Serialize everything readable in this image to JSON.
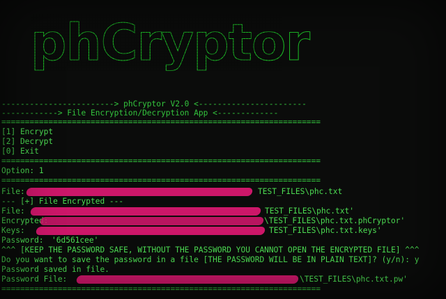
{
  "banner": {
    "text": "phCryptor"
  },
  "lines": {
    "sep1": "------------------------> phCryptor V2.0 <-----------------------",
    "sep2": "------------> File Encryption/Decryption App <-------------",
    "sep3": "====================================================================",
    "menu_1": "[1] Encrypt",
    "menu_2": "[2] Decrypt",
    "menu_0": "[0] Exit",
    "sep4": "====================================================================",
    "option": "Option: 1",
    "sep5": "====================================================================",
    "file_label": "File:",
    "file_tail": "TEST_FILES\\phc.txt",
    "encrypted_header": "--- [+] File Encrypted ---",
    "file2_label": "File:",
    "file2_tail": "TEST_FILES\\phc.txt'",
    "encrypted_label": "Encrypted:",
    "encrypted_tail": "\\TEST_FILES\\phc.txt.phCryptor'",
    "keys_label": "Keys:",
    "keys_tail": "TEST_FILES\\phc.txt.keys'",
    "password_label": "Password:",
    "password_value": "'6d561cee'",
    "warning": "^^^ [KEEP THE PASSWORD SAFE, WITHOUT THE PASSWORD YOU CANNOT OPEN THE ENCRYPTED FILE] ^^^",
    "save_prompt": "Do you want to save the password in a file [THE PASSWORD WILL BE IN PLAIN TEXT]? (y/n): y",
    "saved_msg": "Password saved in file.",
    "password_file_label": "Password File:",
    "password_file_tail": "\\TEST_FILES\\phc.txt.pw'",
    "sep6": "===================================================================="
  },
  "colors": {
    "background": "#0b0c0b",
    "terminal_green": "#4cdc52",
    "banner_green": "#1fd02a",
    "redaction_pink": "#d7186f"
  }
}
